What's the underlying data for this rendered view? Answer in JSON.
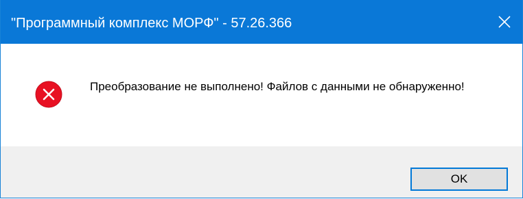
{
  "window": {
    "title": "\"Программный комплекс МОРФ\" - 57.26.366",
    "close_icon": "close-icon",
    "titlebar_color": "#0a78d7"
  },
  "message": {
    "icon": "error-icon",
    "icon_color": "#e81123",
    "text": "Преобразование не выполнено! Файлов с данными не обнаруженно!"
  },
  "buttons": {
    "ok_label": "OK"
  }
}
